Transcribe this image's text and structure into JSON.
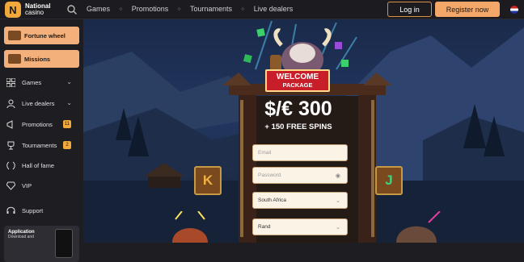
{
  "brand": {
    "logo_letter": "N",
    "name_line1": "National",
    "name_line2": "casino"
  },
  "topnav": {
    "items": [
      "Games",
      "Promotions",
      "Tournaments",
      "Live dealers"
    ],
    "login_label": "Log in",
    "register_label": "Register now",
    "search_icon": "search-icon",
    "language_icon": "uk-flag-icon"
  },
  "sidebar": {
    "promos": [
      {
        "label": "Fortune wheel",
        "icon": "wheel-icon"
      },
      {
        "label": "Missions",
        "icon": "chest-icon"
      }
    ],
    "items": [
      {
        "label": "Games",
        "icon": "grid-icon",
        "chevron": true
      },
      {
        "label": "Live dealers",
        "icon": "user-icon",
        "chevron": true
      },
      {
        "label": "Promotions",
        "icon": "megaphone-icon",
        "badge": "11"
      },
      {
        "label": "Tournaments",
        "icon": "trophy-icon",
        "badge": "2"
      },
      {
        "label": "Hall of fame",
        "icon": "laurel-icon"
      },
      {
        "label": "VIP",
        "icon": "diamond-icon"
      },
      {
        "label": "Support",
        "icon": "headset-icon"
      }
    ],
    "app": {
      "title": "Application",
      "subtitle": "Download and"
    }
  },
  "welcome": {
    "banner_line1": "WELCOME",
    "banner_line2": "PACKAGE",
    "amount": "$/€ 300",
    "spins": "+ 150 FREE SPINS"
  },
  "form": {
    "email_placeholder": "Email",
    "password_placeholder": "Password",
    "country_value": "South Africa",
    "currency_value": "Rand"
  },
  "runes": {
    "left": "K",
    "right": "J"
  },
  "colors": {
    "accent": "#f3a86a",
    "banner_red": "#c81e2a",
    "brand": "#f0a93a"
  }
}
